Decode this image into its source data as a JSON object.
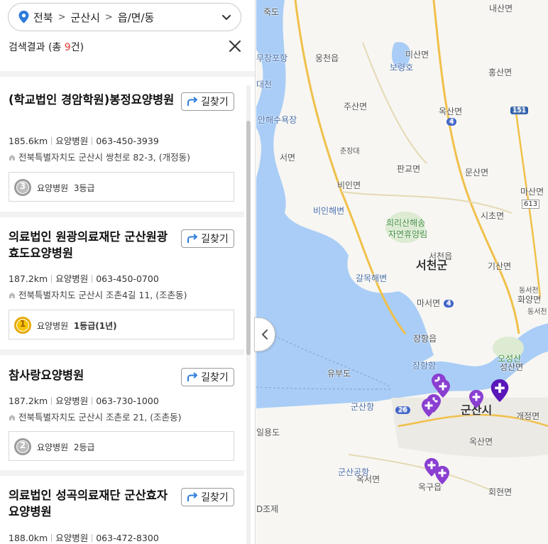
{
  "region": {
    "crumbs": [
      "전북",
      "군산시",
      "읍/면/동"
    ]
  },
  "results": {
    "prefix": "검색결과 (총 ",
    "count": "9",
    "suffix": "건)"
  },
  "items": [
    {
      "name": "(학교법인 경암학원)봉정요양병원",
      "route_label": "길찾기",
      "distance": "185.6km",
      "category": "요양병원",
      "phone": "063-450-3939",
      "address": "전북특별자치도 군산시 쌍천로 82-3, (개정동)",
      "grade_num": "3",
      "grade_type": "요양병원",
      "grade_text": "3등급"
    },
    {
      "name": "의료법인 원광의료재단 군산원광효도요양병원",
      "route_label": "길찾기",
      "distance": "187.2km",
      "category": "요양병원",
      "phone": "063-450-0700",
      "address": "전북특별자치도 군산시 조촌4길 11, (조촌동)",
      "grade_num": "1",
      "grade_type": "요양병원",
      "grade_text": "1등급(1년)"
    },
    {
      "name": "참사랑요양병원",
      "route_label": "길찾기",
      "distance": "187.2km",
      "category": "요양병원",
      "phone": "063-730-1000",
      "address": "전북특별자치도 군산시 조촌로 21, (조촌동)",
      "grade_num": "2",
      "grade_type": "요양병원",
      "grade_text": "2등급"
    },
    {
      "name": "의료법인 성곡의료재단 군산효자요양병원",
      "route_label": "길찾기",
      "distance": "188.0km",
      "category": "요양병원",
      "phone": "063-472-8300"
    }
  ],
  "map": {
    "labels": {
      "jukdo": "죽도",
      "naesan": "내산면",
      "ungcheon_eup": "웅천읍",
      "muchangpo": "무창포항",
      "misan": "미산면",
      "boryeong_lake": "보령호",
      "hongsan": "홍산면",
      "daecheon": "대천",
      "jusan": "주산면",
      "oksan_n": "옥산면",
      "haesuyokjang": "안해수욕장",
      "road151": "151",
      "seomyeon": "서면",
      "chunjangdae": "춘장대",
      "road4a": "4",
      "pangyo": "판교면",
      "munsan": "문산면",
      "biin": "비인면",
      "masan": "마산면",
      "biinhaebyeon": "비인해변",
      "road613": "613",
      "huiri_a": "희리산해송",
      "huiri_b": "자연휴양림",
      "sicho": "시초면",
      "seocheon_eup": "서천읍",
      "seocheongun": "서천군",
      "gisan": "기산면",
      "galmok": "갈목해변",
      "dongseo": "동서천",
      "hwayang": "화양면",
      "masan_s": "마서면",
      "road4b": "4",
      "dongseo_jc": "동서천",
      "janghang_eup": "장항읍",
      "janghang_hang": "장항항",
      "osung_a": "오성산",
      "osung_b": "성산면",
      "yubudo": "유부도",
      "gunsanhang": "군산항",
      "road26": "26",
      "gunsansi": "군산시",
      "gaejeong": "개정면",
      "ilyongdo": "일용도",
      "oksan_s": "옥산면",
      "airport": "군산공항",
      "okseo": "옥서면",
      "okgu": "옥구읍",
      "hoehyeon": "회현면",
      "jojae": "D조제"
    }
  },
  "colors": {
    "accent_blue": "#2e7bd8",
    "count_red": "#e23b2e",
    "marker_purple": "#8a3fd1",
    "marker_dark": "#5a16b8",
    "sea": "#a9cdf6",
    "land": "#f7f6f2"
  },
  "icons": {
    "pin": "location-pin-icon",
    "chevron": "chevron-down-icon",
    "close": "close-icon",
    "route": "route-arrow-icon",
    "address": "building-icon",
    "grade": "grade-medal-icon",
    "collapse": "chevron-left-icon",
    "hospital": "hospital-marker-icon"
  }
}
